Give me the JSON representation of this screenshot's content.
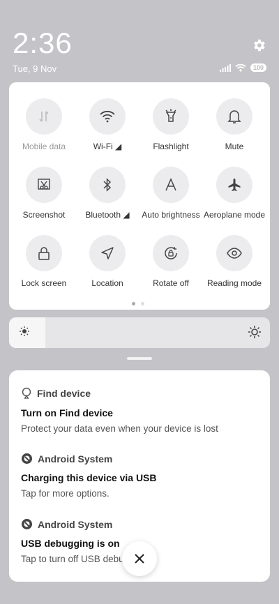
{
  "status": {
    "time": "2:36",
    "date": "Tue, 9 Nov",
    "battery": "100"
  },
  "quick_settings": {
    "tiles": [
      {
        "label": "Mobile data",
        "icon": "mobile-data-icon",
        "active": false
      },
      {
        "label": "Wi-Fi ◢",
        "icon": "wifi-icon",
        "active": true
      },
      {
        "label": "Flashlight",
        "icon": "flashlight-icon",
        "active": false
      },
      {
        "label": "Mute",
        "icon": "bell-icon",
        "active": false
      },
      {
        "label": "Screenshot",
        "icon": "screenshot-icon",
        "active": false
      },
      {
        "label": "Bluetooth ◢",
        "icon": "bluetooth-icon",
        "active": false
      },
      {
        "label": "Auto brightness",
        "icon": "auto-brightness-icon",
        "active": false
      },
      {
        "label": "Aeroplane mode",
        "icon": "airplane-icon",
        "active": false
      },
      {
        "label": "Lock screen",
        "icon": "lock-icon",
        "active": false
      },
      {
        "label": "Location",
        "icon": "location-icon",
        "active": false
      },
      {
        "label": "Rotate off",
        "icon": "rotate-lock-icon",
        "active": false
      },
      {
        "label": "Reading mode",
        "icon": "eye-icon",
        "active": false
      }
    ],
    "page_count": 2,
    "current_page": 1
  },
  "brightness": {
    "level": 0.14
  },
  "notifications": [
    {
      "app": "Find device",
      "icon": "find-device-icon",
      "title": "Turn on Find device",
      "text": "Protect your data even when your device is lost"
    },
    {
      "app": "Android System",
      "icon": "android-system-icon",
      "title": "Charging this device via USB",
      "text": "Tap for more options."
    },
    {
      "app": "Android System",
      "icon": "android-system-icon",
      "title": "USB debugging is on",
      "text": "Tap to turn off USB debugging"
    }
  ]
}
